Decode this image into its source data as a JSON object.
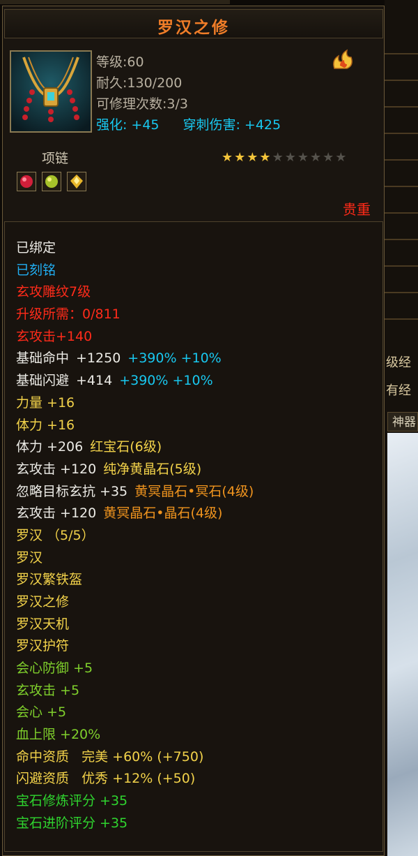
{
  "background": {
    "right_items": [
      "级经",
      "有经"
    ],
    "tab_label": "神器"
  },
  "tooltip": {
    "title": "罗汉之修",
    "level_line": "等级:60",
    "durability_line": "耐久:130/200",
    "repair_line": "可修理次数:3/3",
    "enhance_label": "强化:",
    "enhance_value": "+45",
    "pierce_label": "穿刺伤害:",
    "pierce_value": "+425",
    "category": "项链",
    "stars_filled": 4,
    "stars_total": 10,
    "rarity": "贵重",
    "bound": "已绑定",
    "engraved": "已刻铭",
    "carving": "玄攻雕纹7级",
    "upgrade_req": "升级所需：0/811",
    "xuan_attack": "玄攻击+140",
    "hit_label": "基础命中",
    "hit_base": "+1250",
    "hit_bonus": "+390% +10%",
    "dodge_label": "基础闪避",
    "dodge_base": "+414",
    "dodge_bonus": "+390% +10%",
    "strength": "力量 +16",
    "stamina": "体力 +16",
    "gem1_stat": "体力 +206",
    "gem1_name": "红宝石(6级)",
    "gem2_stat": "玄攻击 +120",
    "gem2_name": "纯净黄晶石(5级)",
    "gem3_stat": "忽略目标玄抗 +35",
    "gem3_name": "黄冥晶石•冥石(4级)",
    "gem4_stat": "玄攻击 +120",
    "gem4_name": "黄冥晶石•晶石(4级)",
    "set_name": "罗汉 （5/5）",
    "set_items": [
      "罗汉",
      "罗汉繁铁盔",
      "罗汉之修",
      "罗汉天机",
      "罗汉护符"
    ],
    "set_bonuses": [
      "会心防御 +5",
      "玄攻击 +5",
      "会心 +5",
      "血上限 +20%"
    ],
    "hit_aptitude": "命中资质   完美 +60% (+750)",
    "dodge_aptitude": "闪避资质   优秀 +12% (+50)",
    "gem_refine_score": "宝石修炼评分 +35",
    "gem_advance_score": "宝石进阶评分 +35"
  },
  "colors": {
    "title": "#f07d28",
    "bound": "#ecebe6",
    "engraved": "#21aef2",
    "red_attr": "#ff2b1a",
    "yellow_attr": "#f2d24a",
    "gem_name": "#f0941e",
    "set_bonus": "#7fcf2c",
    "score": "#2fd42f"
  }
}
